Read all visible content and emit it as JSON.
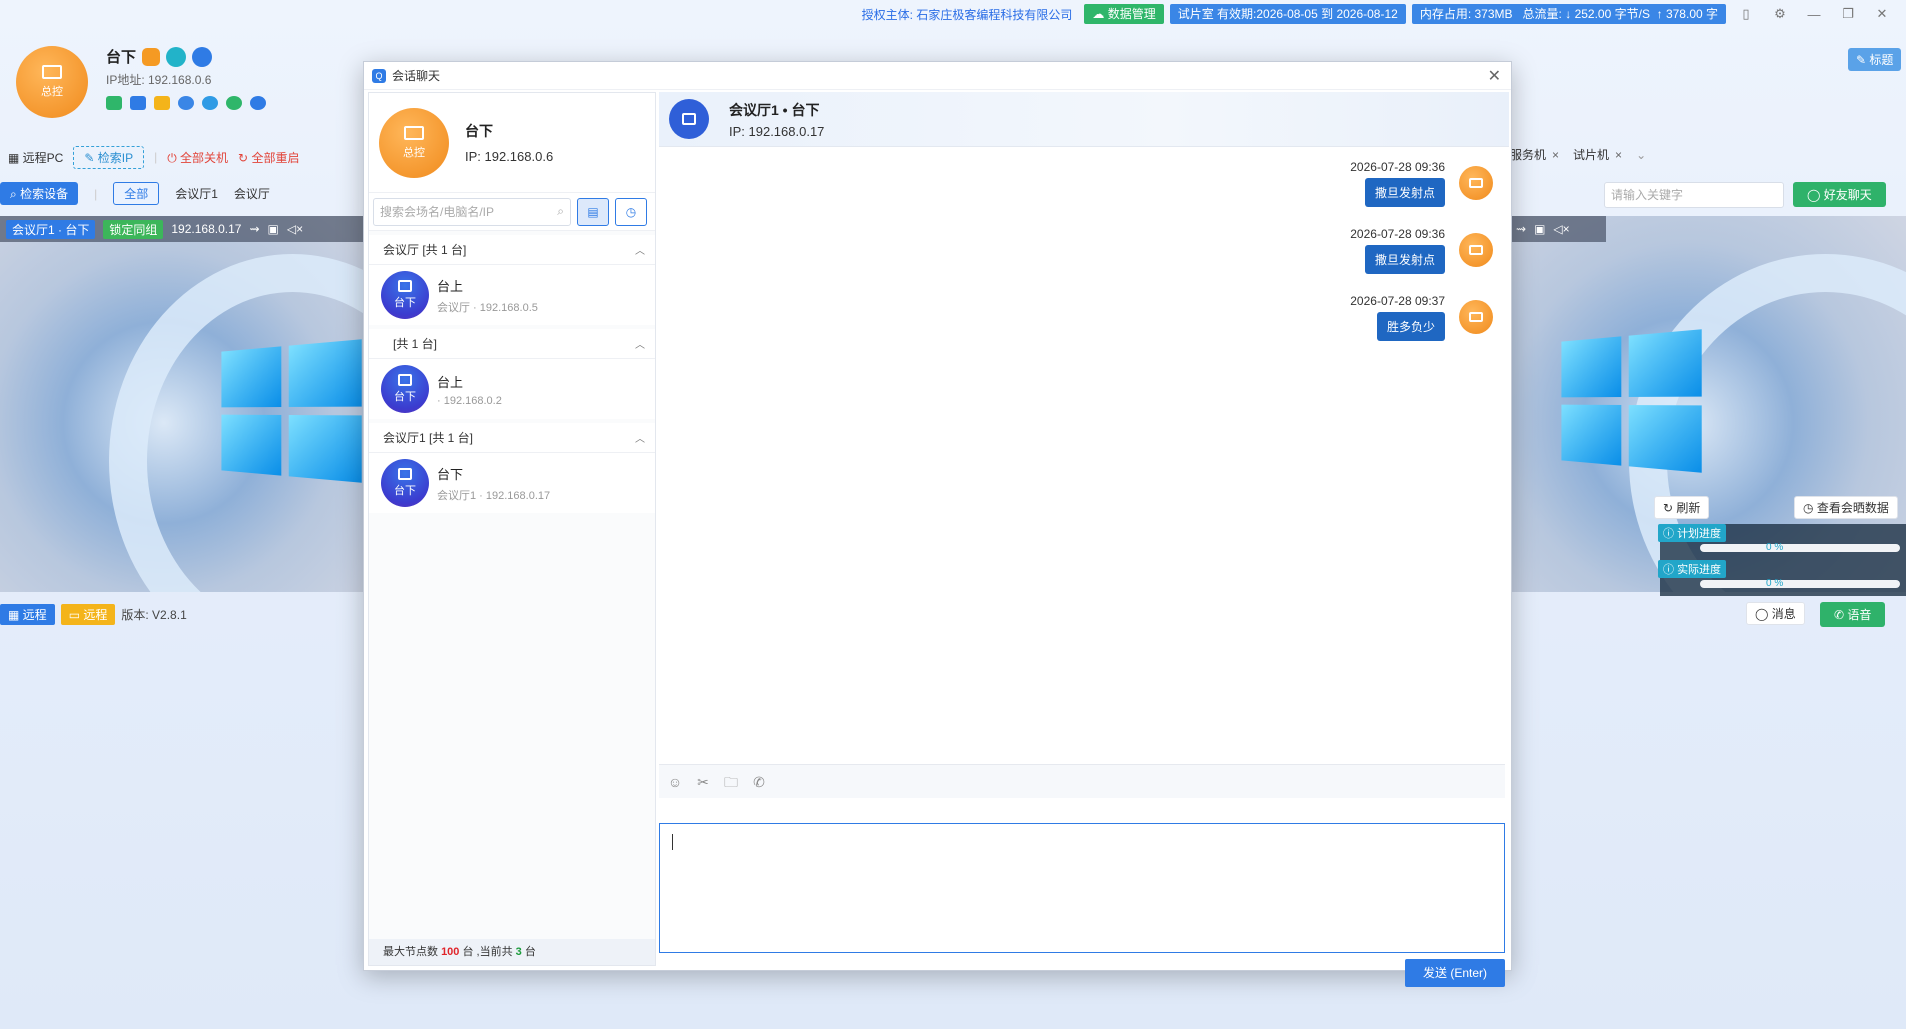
{
  "topbar": {
    "auth_label": "授权主体:",
    "auth_company": "石家庄极客编程科技有限公司",
    "data_mgmt": "数据管理",
    "validity": "试片室 有效期:2026-08-05 到 2026-08-12",
    "memory": "内存占用: 373MB",
    "traffic_label": "总流量:",
    "download": "↓ 252.00 字节/S",
    "upload": "↑ 378.00 字"
  },
  "profile": {
    "avatar_label": "总控",
    "name": "台下",
    "ip": "IP地址: 192.168.0.6"
  },
  "left_toolbar": {
    "remote_pc": "远程PC",
    "search_ip": "检索IP",
    "shutdown_all": "全部关机",
    "restart_all": "全部重启"
  },
  "left_tabs": {
    "search_device": "检索设备",
    "all": "全部",
    "hall1": "会议厅1",
    "hall": "会议厅"
  },
  "left_tile": {
    "tag": "会议厅1 · 台下",
    "lock": "锁定同组",
    "ip": "192.168.0.17"
  },
  "left_bottom": {
    "remote1": "远程",
    "remote2": "远程",
    "version": "版本: V2.8.1"
  },
  "right_side": {
    "mark": "标题",
    "tab1": "服务机",
    "tab2": "试片机",
    "search_placeholder": "请输入关键字",
    "friend_chat": "好友聊天",
    "refresh": "刷新",
    "view_data": "查看会晒数据",
    "plan_progress": "计划进度",
    "plan_value": 0,
    "plan_pct": "0 %",
    "actual_progress": "实际进度",
    "actual_value": 0,
    "actual_pct": "0 %",
    "message": "消息",
    "voice": "语音"
  },
  "dialog": {
    "title": "会话聊天",
    "me": {
      "avatar_label": "总控",
      "name": "台下",
      "ip": "IP:   192.168.0.6"
    },
    "search_placeholder": "搜索会场名/电脑名/IP",
    "groups": [
      {
        "header": "会议厅   [共 1 台]",
        "item_name": "台上",
        "item_sub": "会议厅 · 192.168.0.5",
        "avatar_label": "台下"
      },
      {
        "header": "[共 1 台]",
        "item_name": "台上",
        "item_sub": " · 192.168.0.2",
        "avatar_label": "台下"
      },
      {
        "header": "会议厅1   [共 1 台]",
        "item_name": "台下",
        "item_sub": "会议厅1 · 192.168.0.17",
        "avatar_label": "台下"
      }
    ],
    "footer": {
      "prefix": "最大节点数",
      "max": "100",
      "mid": "台 ,当前共",
      "current": "3",
      "suffix": "台"
    },
    "chat": {
      "title": "会议厅1 • 台下",
      "ip": "IP:   192.168.0.17",
      "messages": [
        {
          "time": "2026-07-28 09:36",
          "text": "撒旦发射点"
        },
        {
          "time": "2026-07-28 09:36",
          "text": "撒旦发射点"
        },
        {
          "time": "2026-07-28 09:37",
          "text": "胜多负少"
        }
      ],
      "send": "发送 (Enter)"
    }
  }
}
